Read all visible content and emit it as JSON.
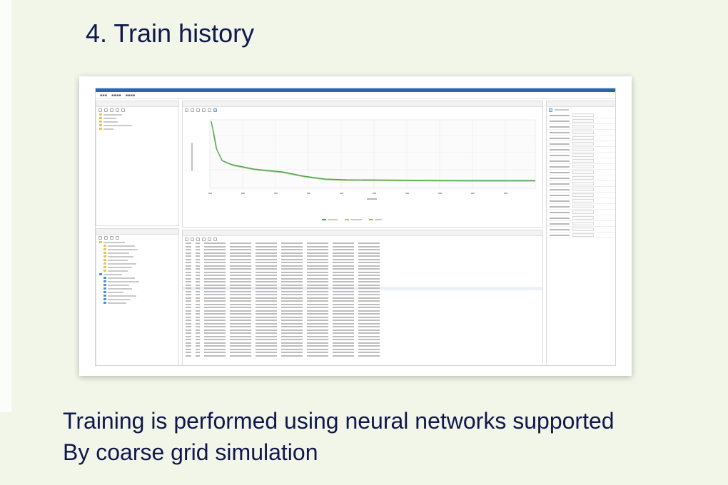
{
  "slide": {
    "title": "4. Train history",
    "caption_line1": "Training is performed using neural networks supported",
    "caption_line2": "By coarse grid simulation"
  },
  "app": {
    "accent_color": "#2b63b5",
    "chart_curve_color": "#4aa34a",
    "chart_curve_color_2": "#a8c48a"
  }
}
